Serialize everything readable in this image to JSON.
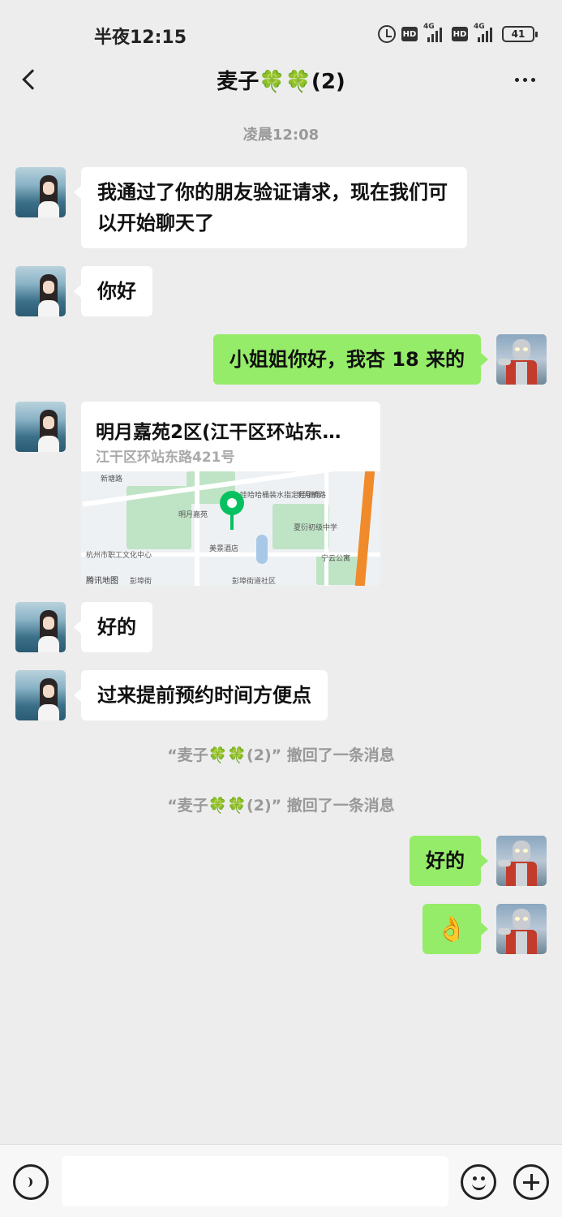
{
  "status_bar": {
    "time": "半夜12:15",
    "hd1": "HD",
    "sig1": "4G",
    "hd2": "HD",
    "sig2": "4G",
    "battery": "41"
  },
  "nav": {
    "title": "麦子🍀🍀(2)",
    "back_icon": "chevron-left-icon",
    "more_icon": "more-dots-icon"
  },
  "chat": {
    "timestamp": "凌晨12:08",
    "messages": [
      {
        "side": "in",
        "type": "text",
        "text": "我通过了你的朋友验证请求，现在我们可以开始聊天了"
      },
      {
        "side": "in",
        "type": "text",
        "text": "你好"
      },
      {
        "side": "out",
        "type": "text",
        "text": "小姐姐你好，我杏 18 来的"
      },
      {
        "side": "in",
        "type": "location",
        "title": "明月嘉苑2区(江干区环站东…",
        "address": "江干区环站东路421号",
        "map_labels": [
          "新塘路",
          "明月嘉苑",
          "哇哈哈桶装水指定经销商",
          "明月桥路",
          "夏衍初级中学",
          "杭州市职工文化中心",
          "美景酒店",
          "宁云公寓",
          "彭埠街道社区",
          "彭埠街",
          "腾讯地图"
        ]
      },
      {
        "side": "in",
        "type": "text",
        "text": "好的"
      },
      {
        "side": "in",
        "type": "text",
        "text": "过来提前预约时间方便点"
      },
      {
        "side": "system",
        "type": "recall",
        "text": "“麦子🍀🍀(2)” 撤回了一条消息"
      },
      {
        "side": "system",
        "type": "recall",
        "text": "“麦子🍀🍀(2)” 撤回了一条消息"
      },
      {
        "side": "out",
        "type": "text",
        "text": "好的"
      },
      {
        "side": "out",
        "type": "emoji",
        "text": "👌"
      }
    ]
  },
  "input_bar": {
    "voice_icon": "voice-icon",
    "emoji_icon": "emoji-face-icon",
    "plus_icon": "plus-icon",
    "placeholder": ""
  },
  "colors": {
    "bg": "#ededed",
    "outgoing_bubble": "#95ec69",
    "incoming_bubble": "#ffffff",
    "pin": "#07c160"
  }
}
